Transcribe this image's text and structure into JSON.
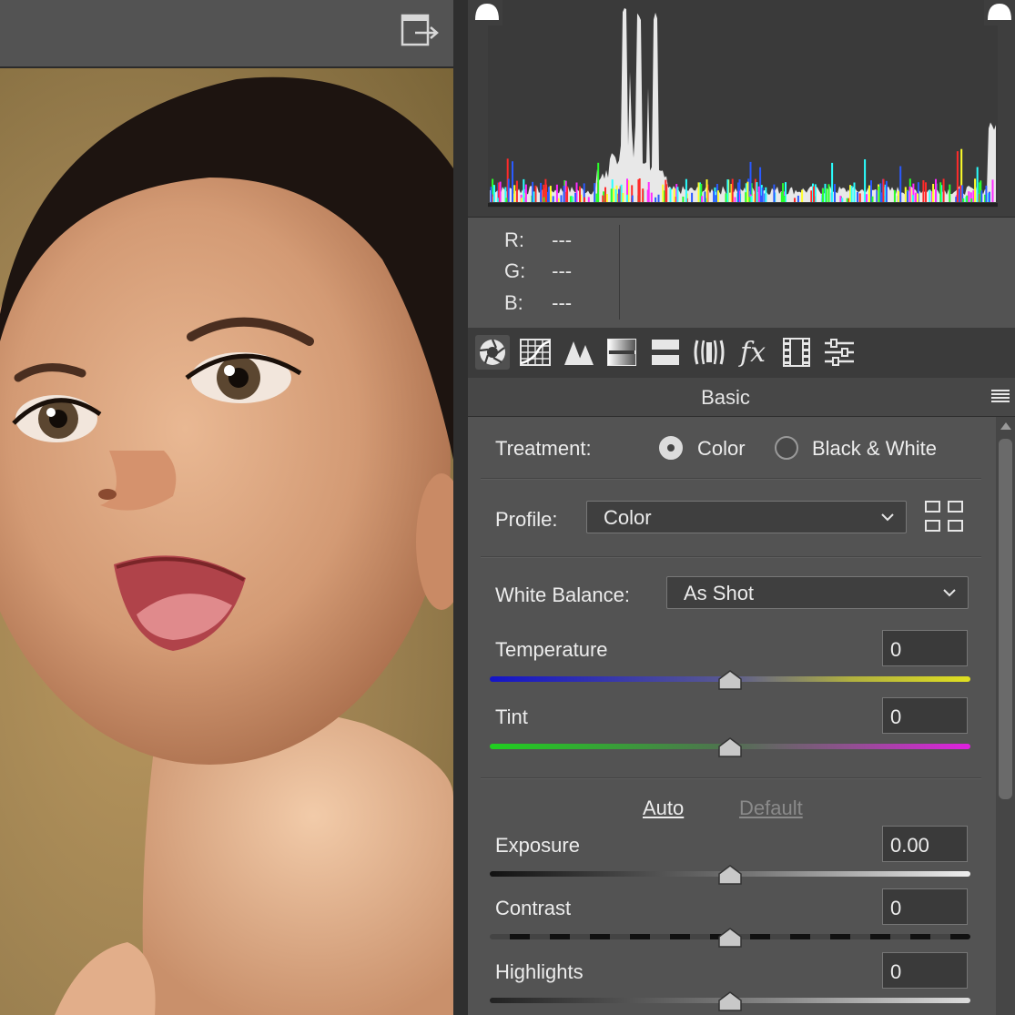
{
  "histogram": {
    "channels": [
      "red",
      "green",
      "blue",
      "white"
    ]
  },
  "readout": {
    "r_label": "R:",
    "r_value": "---",
    "g_label": "G:",
    "g_value": "---",
    "b_label": "B:",
    "b_value": "---"
  },
  "tools": [
    {
      "icon": "aperture-icon",
      "active": true
    },
    {
      "icon": "tone-curve-grid-icon",
      "active": false
    },
    {
      "icon": "detail-triangles-icon",
      "active": false
    },
    {
      "icon": "hsl-bars-icon",
      "active": false
    },
    {
      "icon": "split-toning-icon",
      "active": false
    },
    {
      "icon": "lens-corrections-icon",
      "active": false
    },
    {
      "icon": "effects-fx-icon",
      "active": false
    },
    {
      "icon": "calibration-film-icon",
      "active": false
    },
    {
      "icon": "presets-sliders-icon",
      "active": false
    }
  ],
  "panel": {
    "title": "Basic",
    "treatment_label": "Treatment:",
    "treatment_options": [
      "Color",
      "Black & White"
    ],
    "treatment_selected": "Color",
    "profile_label": "Profile:",
    "profile_value": "Color",
    "white_balance_label": "White Balance:",
    "white_balance_value": "As Shot",
    "auto_label": "Auto",
    "default_label": "Default",
    "sliders": {
      "temperature": {
        "label": "Temperature",
        "value": "0",
        "level": 0.5
      },
      "tint": {
        "label": "Tint",
        "value": "0",
        "level": 0.5
      },
      "exposure": {
        "label": "Exposure",
        "value": "0.00",
        "level": 0.5
      },
      "contrast": {
        "label": "Contrast",
        "value": "0",
        "level": 0.5
      },
      "highlights": {
        "label": "Highlights",
        "value": "0",
        "level": 0.5
      }
    }
  },
  "colors": {
    "panel_bg": "#535353",
    "temperature_start": "#1414c8",
    "temperature_end": "#e0e020",
    "tint_start": "#20d020",
    "tint_end": "#e020e0"
  }
}
